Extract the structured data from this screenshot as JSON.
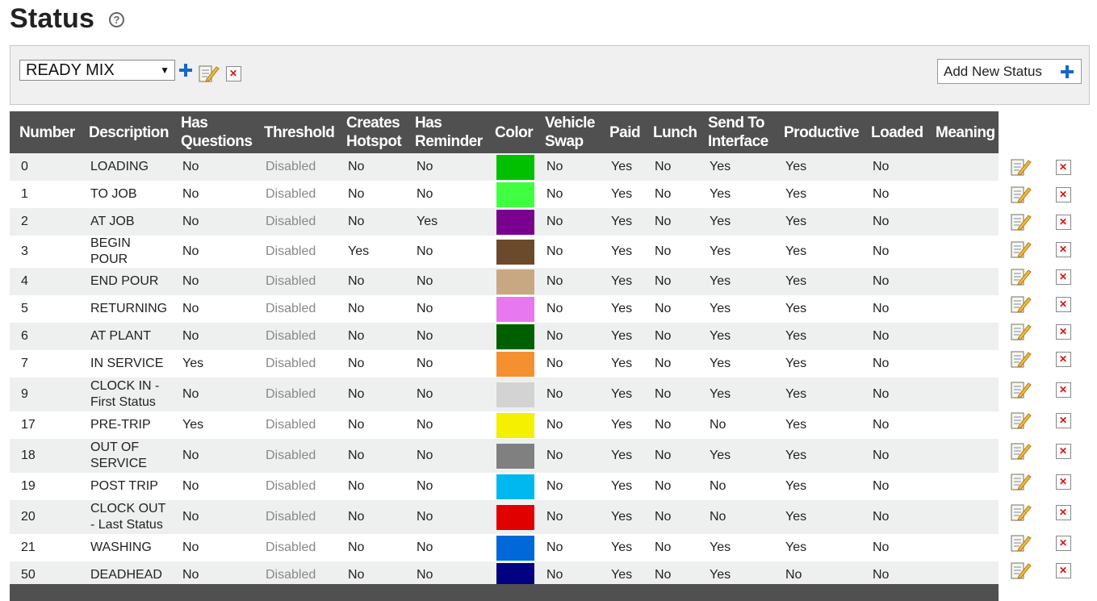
{
  "page": {
    "title": "Status",
    "help_icon": "?"
  },
  "toolbar": {
    "selected_group": "READY MIX",
    "dropdown_arrow": "▼",
    "add_new_status_label": "Add New Status"
  },
  "table": {
    "headers": [
      "Number",
      "Description",
      "Has Questions",
      "Threshold",
      "Creates Hotspot",
      "Has Reminder",
      "Color",
      "Vehicle Swap",
      "Paid",
      "Lunch",
      "Send To Interface",
      "Productive",
      "Loaded",
      "Meaning"
    ],
    "rows": [
      {
        "number": "0",
        "description": "LOADING",
        "has_questions": "No",
        "threshold": "Disabled",
        "creates_hotspot": "No",
        "has_reminder": "No",
        "color": "#00c000",
        "vehicle_swap": "No",
        "paid": "Yes",
        "lunch": "No",
        "send_to_interface": "Yes",
        "productive": "Yes",
        "loaded": "No",
        "meaning": ""
      },
      {
        "number": "1",
        "description": "TO JOB",
        "has_questions": "No",
        "threshold": "Disabled",
        "creates_hotspot": "No",
        "has_reminder": "No",
        "color": "#40ff40",
        "vehicle_swap": "No",
        "paid": "Yes",
        "lunch": "No",
        "send_to_interface": "Yes",
        "productive": "Yes",
        "loaded": "No",
        "meaning": ""
      },
      {
        "number": "2",
        "description": "AT JOB",
        "has_questions": "No",
        "threshold": "Disabled",
        "creates_hotspot": "No",
        "has_reminder": "Yes",
        "color": "#7a0090",
        "vehicle_swap": "No",
        "paid": "Yes",
        "lunch": "No",
        "send_to_interface": "Yes",
        "productive": "Yes",
        "loaded": "No",
        "meaning": ""
      },
      {
        "number": "3",
        "description": "BEGIN POUR",
        "has_questions": "No",
        "threshold": "Disabled",
        "creates_hotspot": "Yes",
        "has_reminder": "No",
        "color": "#6b4a2c",
        "vehicle_swap": "No",
        "paid": "Yes",
        "lunch": "No",
        "send_to_interface": "Yes",
        "productive": "Yes",
        "loaded": "No",
        "meaning": ""
      },
      {
        "number": "4",
        "description": "END POUR",
        "has_questions": "No",
        "threshold": "Disabled",
        "creates_hotspot": "No",
        "has_reminder": "No",
        "color": "#c8a882",
        "vehicle_swap": "No",
        "paid": "Yes",
        "lunch": "No",
        "send_to_interface": "Yes",
        "productive": "Yes",
        "loaded": "No",
        "meaning": ""
      },
      {
        "number": "5",
        "description": "RETURNING",
        "has_questions": "No",
        "threshold": "Disabled",
        "creates_hotspot": "No",
        "has_reminder": "No",
        "color": "#e878f0",
        "vehicle_swap": "No",
        "paid": "Yes",
        "lunch": "No",
        "send_to_interface": "Yes",
        "productive": "Yes",
        "loaded": "No",
        "meaning": ""
      },
      {
        "number": "6",
        "description": "AT PLANT",
        "has_questions": "No",
        "threshold": "Disabled",
        "creates_hotspot": "No",
        "has_reminder": "No",
        "color": "#006000",
        "vehicle_swap": "No",
        "paid": "Yes",
        "lunch": "No",
        "send_to_interface": "Yes",
        "productive": "Yes",
        "loaded": "No",
        "meaning": ""
      },
      {
        "number": "7",
        "description": "IN SERVICE",
        "has_questions": "Yes",
        "threshold": "Disabled",
        "creates_hotspot": "No",
        "has_reminder": "No",
        "color": "#f59030",
        "vehicle_swap": "No",
        "paid": "Yes",
        "lunch": "No",
        "send_to_interface": "Yes",
        "productive": "Yes",
        "loaded": "No",
        "meaning": ""
      },
      {
        "number": "9",
        "description": "CLOCK IN - First Status",
        "has_questions": "No",
        "threshold": "Disabled",
        "creates_hotspot": "No",
        "has_reminder": "No",
        "color": "#d3d3d3",
        "vehicle_swap": "No",
        "paid": "Yes",
        "lunch": "No",
        "send_to_interface": "Yes",
        "productive": "Yes",
        "loaded": "No",
        "meaning": ""
      },
      {
        "number": "17",
        "description": "PRE-TRIP",
        "has_questions": "Yes",
        "threshold": "Disabled",
        "creates_hotspot": "No",
        "has_reminder": "No",
        "color": "#f5f000",
        "vehicle_swap": "No",
        "paid": "Yes",
        "lunch": "No",
        "send_to_interface": "No",
        "productive": "Yes",
        "loaded": "No",
        "meaning": ""
      },
      {
        "number": "18",
        "description": "OUT OF SERVICE",
        "has_questions": "No",
        "threshold": "Disabled",
        "creates_hotspot": "No",
        "has_reminder": "No",
        "color": "#808080",
        "vehicle_swap": "No",
        "paid": "Yes",
        "lunch": "No",
        "send_to_interface": "Yes",
        "productive": "Yes",
        "loaded": "No",
        "meaning": ""
      },
      {
        "number": "19",
        "description": "POST TRIP",
        "has_questions": "No",
        "threshold": "Disabled",
        "creates_hotspot": "No",
        "has_reminder": "No",
        "color": "#00b8f0",
        "vehicle_swap": "No",
        "paid": "Yes",
        "lunch": "No",
        "send_to_interface": "No",
        "productive": "Yes",
        "loaded": "No",
        "meaning": ""
      },
      {
        "number": "20",
        "description": "CLOCK OUT - Last Status",
        "has_questions": "No",
        "threshold": "Disabled",
        "creates_hotspot": "No",
        "has_reminder": "No",
        "color": "#e00000",
        "vehicle_swap": "No",
        "paid": "Yes",
        "lunch": "No",
        "send_to_interface": "No",
        "productive": "Yes",
        "loaded": "No",
        "meaning": ""
      },
      {
        "number": "21",
        "description": "WASHING",
        "has_questions": "No",
        "threshold": "Disabled",
        "creates_hotspot": "No",
        "has_reminder": "No",
        "color": "#0068d8",
        "vehicle_swap": "No",
        "paid": "Yes",
        "lunch": "No",
        "send_to_interface": "Yes",
        "productive": "Yes",
        "loaded": "No",
        "meaning": ""
      },
      {
        "number": "50",
        "description": "DEADHEAD",
        "has_questions": "No",
        "threshold": "Disabled",
        "creates_hotspot": "No",
        "has_reminder": "No",
        "color": "#000080",
        "vehicle_swap": "No",
        "paid": "Yes",
        "lunch": "No",
        "send_to_interface": "Yes",
        "productive": "No",
        "loaded": "No",
        "meaning": ""
      }
    ]
  },
  "icons": {
    "plus": "plus-icon",
    "edit": "edit-icon",
    "delete": "delete-icon",
    "help": "help-icon"
  },
  "colors": {
    "header_bg": "#505050",
    "accent_blue": "#1a66cc",
    "delete_red": "#d11111",
    "stripe": "#eef0ef"
  }
}
